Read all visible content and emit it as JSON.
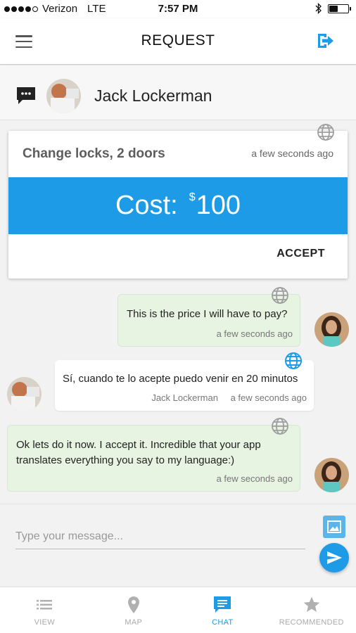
{
  "status_bar": {
    "carrier": "Verizon",
    "network": "LTE",
    "time": "7:57 PM",
    "battery_level": 0.45
  },
  "app_bar": {
    "title": "REQUEST",
    "menu_icon": "hamburger-menu-icon",
    "logout_icon": "logout-icon",
    "accent_color": "#1e9be6"
  },
  "chat_header": {
    "contact_name": "Jack Lockerman"
  },
  "request_card": {
    "job": "Change locks, 2 doors",
    "timestamp": "a few seconds ago",
    "cost_label": "Cost:",
    "cost_currency": "$",
    "cost_amount": "100",
    "accept_label": "ACCEPT"
  },
  "messages": [
    {
      "side": "me",
      "text": "This is the price I will have to pay?",
      "timestamp": "a few seconds ago",
      "translated": false
    },
    {
      "side": "them",
      "text": "Sí, cuando te lo acepte puedo venir en 20 minutos",
      "author": "Jack Lockerman",
      "timestamp": "a few seconds ago",
      "translated": true
    },
    {
      "side": "me",
      "text_line1": "Ok lets do it now. I accept it. Incredible that your app",
      "text_line2": "translates everything you say to my language:)",
      "timestamp": "a few seconds ago",
      "translated": false
    }
  ],
  "composer": {
    "placeholder": "Type your message..."
  },
  "bottom_nav": {
    "tabs": [
      {
        "label": "VIEW",
        "icon": "list-icon",
        "active": false
      },
      {
        "label": "MAP",
        "icon": "map-pin-icon",
        "active": false
      },
      {
        "label": "CHAT",
        "icon": "chat-icon",
        "active": true
      },
      {
        "label": "RECOMMENDED",
        "icon": "star-icon",
        "active": false
      }
    ]
  }
}
